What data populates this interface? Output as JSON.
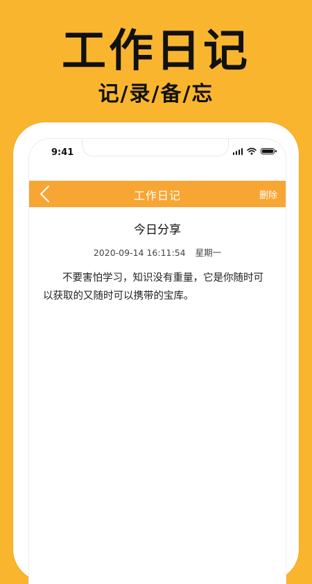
{
  "promo": {
    "title": "工作日记",
    "subtitle": "记/录/备/忘"
  },
  "status_bar": {
    "time": "9:41"
  },
  "nav": {
    "title": "工作日记",
    "delete_label": "删除"
  },
  "entry": {
    "title": "今日分享",
    "datetime": "2020-09-14 16:11:54",
    "weekday": "星期一",
    "body": "不要害怕学习，知识没有重量，它是你随时可以获取的又随时可以携带的宝库。"
  },
  "colors": {
    "background": "#F9B52E",
    "nav_bar": "#F7A634",
    "text": "#111111"
  },
  "icons": [
    "back-arrow-icon",
    "signal-icon",
    "wifi-icon",
    "battery-icon"
  ]
}
